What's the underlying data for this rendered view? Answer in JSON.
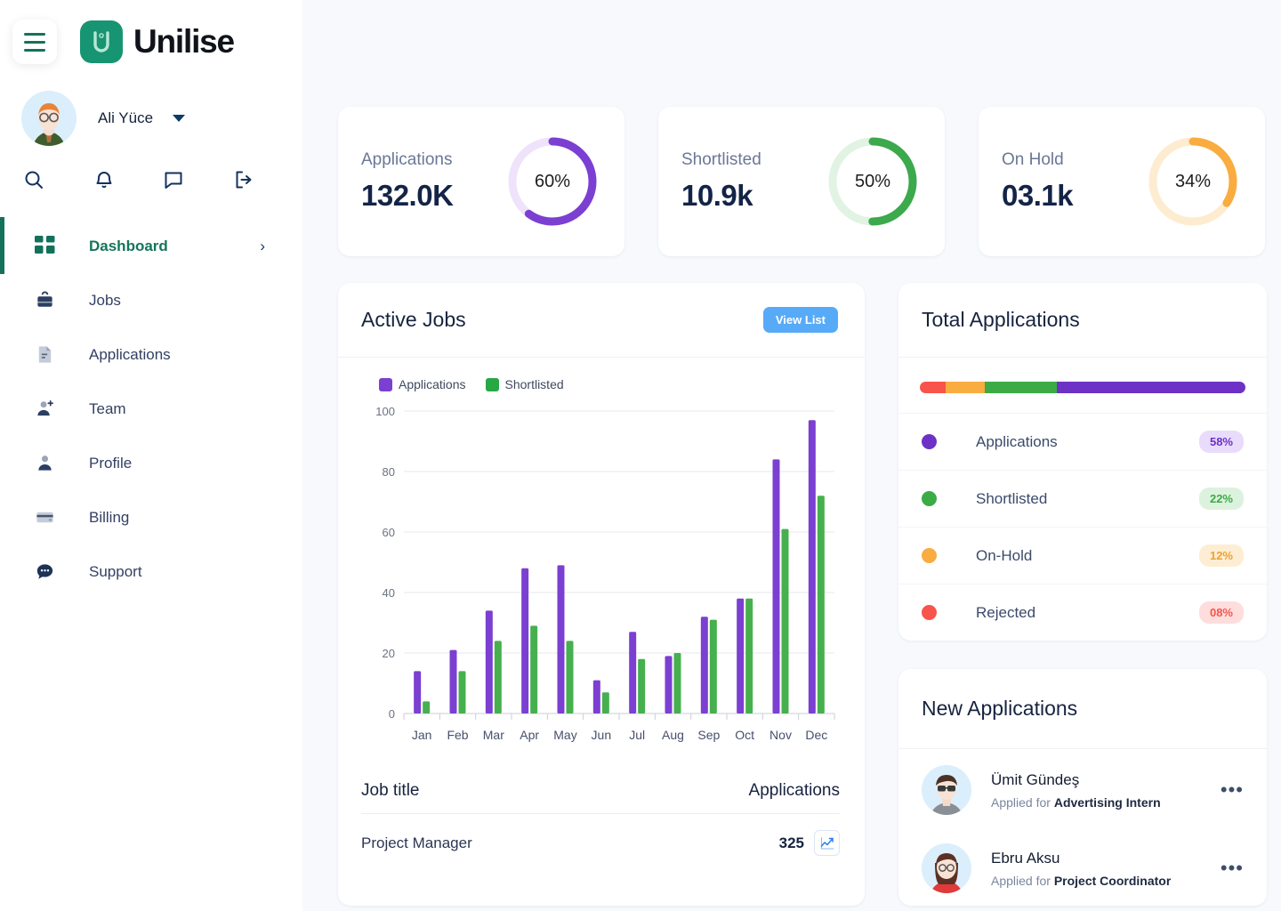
{
  "brand": {
    "name": "Unilise",
    "logo_letter": "U",
    "accent": "#179472"
  },
  "user": {
    "name": "Ali Yüce"
  },
  "quick_icons": [
    {
      "name": "search-icon"
    },
    {
      "name": "bell-icon"
    },
    {
      "name": "message-icon"
    },
    {
      "name": "logout-icon"
    }
  ],
  "sidebar": {
    "items": [
      {
        "label": "Dashboard",
        "icon": "grid-icon",
        "active": true,
        "chevron": "›"
      },
      {
        "label": "Jobs",
        "icon": "briefcase-icon",
        "active": false
      },
      {
        "label": "Applications",
        "icon": "document-icon",
        "active": false
      },
      {
        "label": "Team",
        "icon": "user-plus-icon",
        "active": false
      },
      {
        "label": "Profile",
        "icon": "user-icon",
        "active": false
      },
      {
        "label": "Billing",
        "icon": "card-icon",
        "active": false
      },
      {
        "label": "Support",
        "icon": "chat-dots-icon",
        "active": false
      }
    ]
  },
  "stats": [
    {
      "title": "Applications",
      "value": "132.0K",
      "percent": 60,
      "pct_label": "60%",
      "color": "#7b3fd1",
      "track": "#efe3fb"
    },
    {
      "title": "Shortlisted",
      "value": "10.9k",
      "percent": 50,
      "pct_label": "50%",
      "color": "#3ba94c",
      "track": "#e1f3e3"
    },
    {
      "title": "On Hold",
      "value": "03.1k",
      "percent": 34,
      "pct_label": "34%",
      "color": "#f9ac40",
      "track": "#fdeccf"
    }
  ],
  "active_jobs": {
    "title": "Active Jobs",
    "view_list_label": "View List",
    "table": {
      "col_job": "Job title",
      "col_apps": "Applications",
      "rows": [
        {
          "job": "Project Manager",
          "applications": "325",
          "icon": "trend-chart-icon"
        }
      ]
    }
  },
  "chart_data": {
    "type": "bar",
    "title": "Active Jobs",
    "categories": [
      "Jan",
      "Feb",
      "Mar",
      "Apr",
      "May",
      "Jun",
      "Jul",
      "Aug",
      "Sep",
      "Oct",
      "Nov",
      "Dec"
    ],
    "series": [
      {
        "name": "Applications",
        "color": "#7b3fd1",
        "values": [
          14,
          21,
          34,
          48,
          49,
          11,
          27,
          19,
          32,
          38,
          84,
          97
        ]
      },
      {
        "name": "Shortlisted",
        "color": "#46b04e",
        "values": [
          4,
          14,
          24,
          29,
          24,
          7,
          18,
          20,
          31,
          38,
          61,
          72
        ]
      }
    ],
    "xlabel": "",
    "ylabel": "",
    "ylim": [
      0,
      100
    ],
    "yticks": [
      0,
      20,
      40,
      60,
      80,
      100
    ],
    "grid": true,
    "legend_position": "top-left"
  },
  "total_applications": {
    "title": "Total Applications",
    "segments": [
      {
        "label": "Rejected",
        "percent": 8,
        "color": "#f9544b"
      },
      {
        "label": "On-Hold",
        "percent": 12,
        "color": "#f9ac40"
      },
      {
        "label": "Shortlisted",
        "percent": 22,
        "color": "#3cab46"
      },
      {
        "label": "Applications",
        "percent": 58,
        "color": "#6d31c6"
      }
    ],
    "rows": [
      {
        "label": "Applications",
        "value": "58%",
        "color": "#6d31c6",
        "pill_bg": "#e9dcfb",
        "pill_fg": "#6d31c6"
      },
      {
        "label": "Shortlisted",
        "value": "22%",
        "color": "#3cab46",
        "pill_bg": "#ddf2de",
        "pill_fg": "#3cab46"
      },
      {
        "label": "On-Hold",
        "value": "12%",
        "color": "#f9ac40",
        "pill_bg": "#fdeed3",
        "pill_fg": "#f0a033"
      },
      {
        "label": "Rejected",
        "value": "08%",
        "color": "#f9544b",
        "pill_bg": "#fddedd",
        "pill_fg": "#f9544b"
      }
    ]
  },
  "new_applications": {
    "title": "New Applications",
    "applied_prefix": "Applied for",
    "items": [
      {
        "name": "Ümit Gündeş",
        "role": "Advertising Intern",
        "avatar": "man-sunglasses-avatar",
        "menu": "•••"
      },
      {
        "name": "Ebru Aksu",
        "role": "Project Coordinator",
        "avatar": "woman-glasses-avatar",
        "menu": "•••"
      }
    ]
  }
}
